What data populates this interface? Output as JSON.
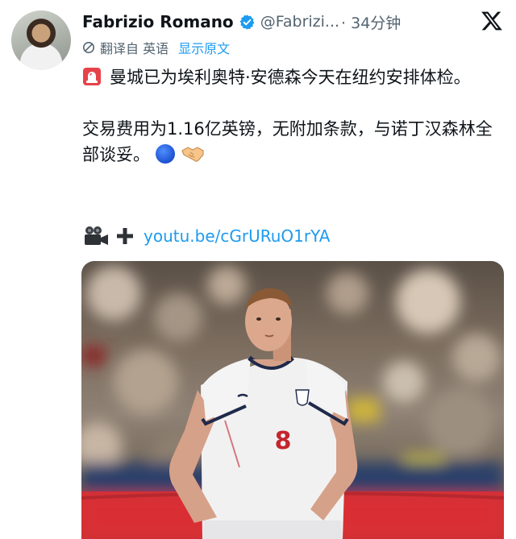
{
  "tweet": {
    "author_name": "Fabrizio Romano",
    "handle": "@Fabrizi...",
    "time": "· 34分钟",
    "translation": {
      "translated_from": "翻译自 英语",
      "show_original": "显示原文"
    },
    "text": {
      "line1": "曼城已为埃利奥特·安德森今天在纽约安排体检。",
      "line2": "交易费用为1.16亿英镑，无附加条款，与诺丁汉森林全部谈妥。"
    },
    "link": "youtu.be/cGrURuO1rYA"
  },
  "media": {
    "shirt_number": "8"
  },
  "colors": {
    "link": "#1d9bf0",
    "verified": "#1d9bf0",
    "secondary_text": "#536471"
  }
}
